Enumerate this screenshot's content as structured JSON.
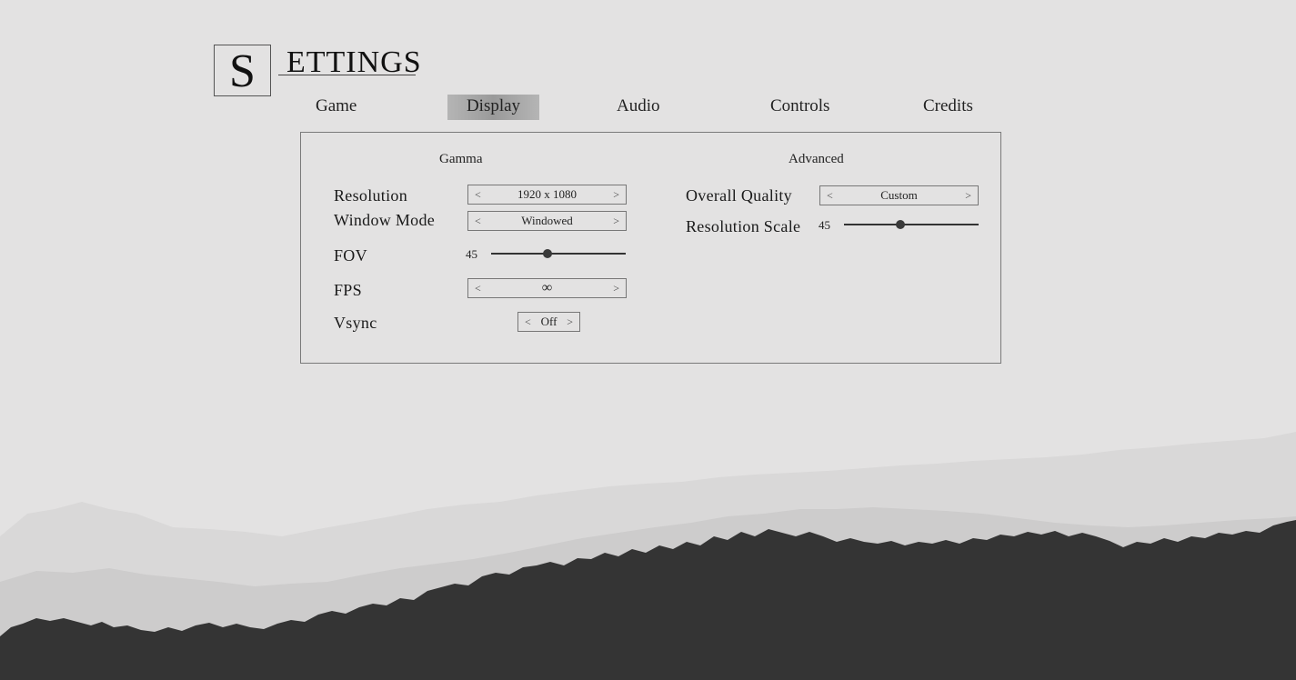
{
  "title": {
    "initial": "S",
    "rest": "ETTINGS"
  },
  "tabs": [
    {
      "label": "Game",
      "active": false
    },
    {
      "label": "Display",
      "active": true
    },
    {
      "label": "Audio",
      "active": false
    },
    {
      "label": "Controls",
      "active": false
    },
    {
      "label": "Credits",
      "active": false
    }
  ],
  "panel": {
    "left_title": "Gamma",
    "right_title": "Advanced",
    "resolution": {
      "label": "Resolution",
      "value": "1920 x 1080",
      "prev": "<",
      "next": ">"
    },
    "window_mode": {
      "label": "Window Mode",
      "value": "Windowed",
      "prev": "<",
      "next": ">"
    },
    "fov": {
      "label": "FOV",
      "value": "45",
      "fraction": 0.42
    },
    "fps": {
      "label": "FPS",
      "value": "∞",
      "prev": "<",
      "next": ">"
    },
    "vsync": {
      "label": "Vsync",
      "value": "Off",
      "prev": "<",
      "next": ">"
    },
    "overall_quality": {
      "label": "Overall Quality",
      "value": "Custom",
      "prev": "<",
      "next": ">"
    },
    "resolution_scale": {
      "label": "Resolution Scale",
      "value": "45",
      "fraction": 0.42
    }
  },
  "colors": {
    "background": "#e3e2e2",
    "mountain_far": "#d6d6d6",
    "mountain_mid": "#cbcbcb",
    "mountain_near": "#343434",
    "active_tab": "#a5a5a5"
  }
}
